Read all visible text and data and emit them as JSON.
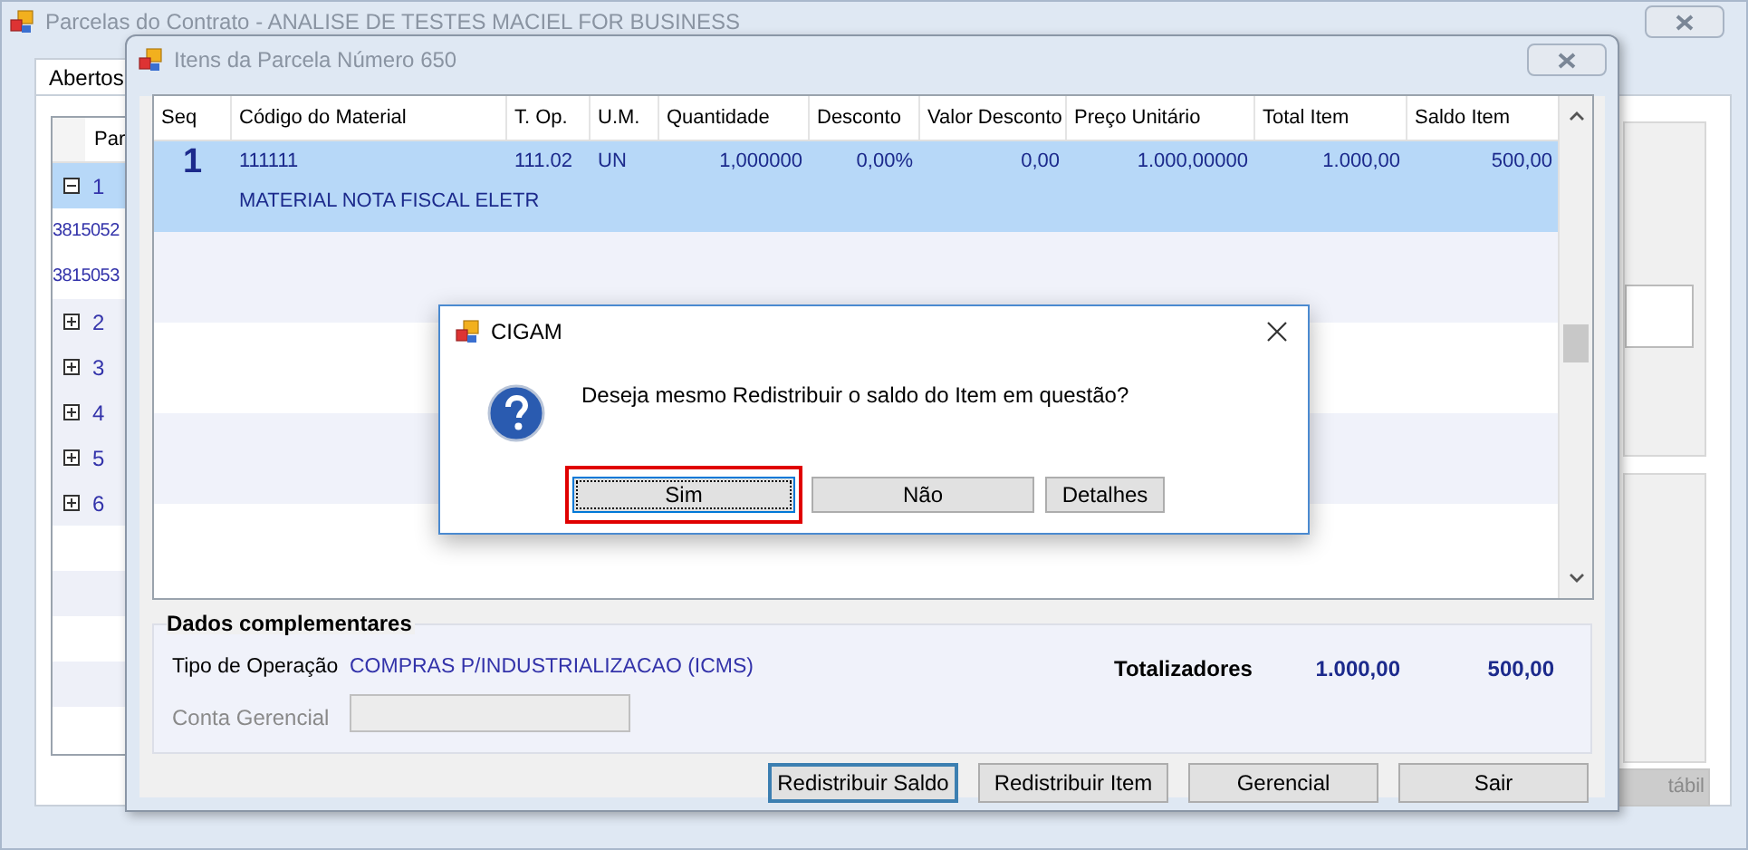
{
  "main_window": {
    "title": "Parcelas do Contrato - ANALISE DE TESTES MACIEL FOR BUSINESS",
    "tabs": [
      {
        "label": "Abertos",
        "selected": true
      }
    ],
    "grid": {
      "column_1": "Par",
      "rows": [
        {
          "label": "1",
          "expanded": true,
          "children": [
            {
              "label": "3815052"
            },
            {
              "label": "3815053"
            }
          ]
        },
        {
          "label": "2",
          "expanded": false
        },
        {
          "label": "3",
          "expanded": false
        },
        {
          "label": "4",
          "expanded": false
        },
        {
          "label": "5",
          "expanded": false
        },
        {
          "label": "6",
          "expanded": false
        }
      ]
    },
    "side_button": {
      "label": "tábil",
      "disabled": true
    }
  },
  "items_window": {
    "title": "Itens da Parcela Número 650",
    "columns": [
      {
        "label": "Seq"
      },
      {
        "label": "Código do Material"
      },
      {
        "label": "T. Op."
      },
      {
        "label": "U.M."
      },
      {
        "label": "Quantidade"
      },
      {
        "label": "Desconto"
      },
      {
        "label": "Valor Desconto"
      },
      {
        "label": "Preço Unitário"
      },
      {
        "label": "Total Item"
      },
      {
        "label": "Saldo Item"
      }
    ],
    "rows": [
      {
        "selected": true,
        "cells": [
          "1",
          "111111",
          "111.02",
          "UN",
          "1,000000",
          "0,00%",
          "0,00",
          "1.000,00000",
          "1.000,00",
          "500,00"
        ],
        "description": "MATERIAL NOTA FISCAL ELETR"
      }
    ],
    "details": {
      "title": "Dados complementares",
      "operation_label": "Tipo de Operação",
      "operation_value": "COMPRAS P/INDUSTRIALIZACAO (ICMS)",
      "account_label": "Conta Gerencial",
      "account_disabled": true,
      "totals_label": "Totalizadores",
      "total_item": "1.000,00",
      "total_balance": "500,00"
    },
    "buttons": [
      {
        "label": "Redistribuir Saldo",
        "focused": true
      },
      {
        "label": "Redistribuir Item",
        "focused": false
      },
      {
        "label": "Gerencial",
        "focused": false
      },
      {
        "label": "Sair",
        "focused": false
      }
    ]
  },
  "dialog": {
    "title": "CIGAM",
    "message": "Deseja mesmo Redistribuir o saldo do Item em questão?",
    "buttons": [
      {
        "label": "Sim",
        "focused": true,
        "highlighted": true
      },
      {
        "label": "Não",
        "focused": false,
        "highlighted": false
      },
      {
        "label": "Detalhes",
        "focused": false,
        "highlighted": false
      }
    ]
  }
}
